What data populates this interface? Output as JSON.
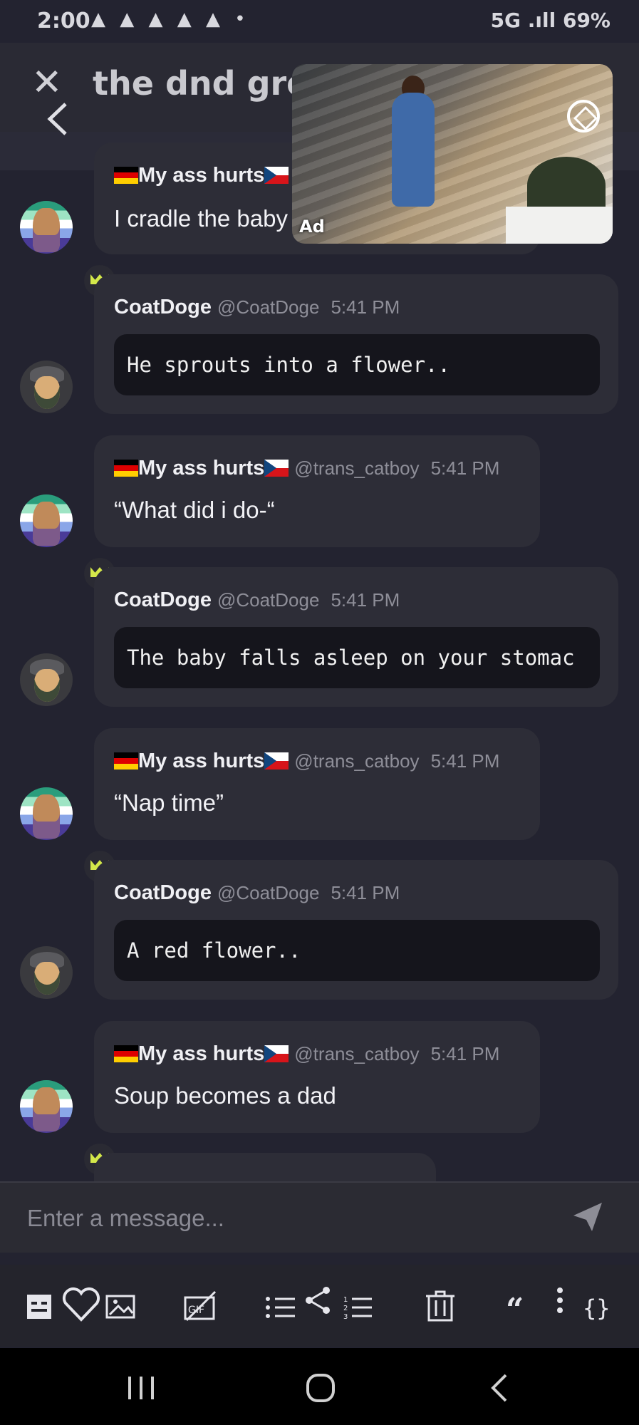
{
  "status_bar": {
    "time": "2:00",
    "notifications": "▲ ▲ ▲ ▲ ▲ •",
    "system": "5G .ıll 69%"
  },
  "header": {
    "title": "the dnd group"
  },
  "ad": {
    "label": "Ad"
  },
  "messages": [
    {
      "author": "My ass hurts",
      "handle": "",
      "time": "",
      "text": "I cradle the baby",
      "kind": "text"
    },
    {
      "author": "CoatDoge",
      "handle": "@CoatDoge",
      "time": "5:41 PM",
      "text": "He sprouts into a flower..",
      "kind": "code"
    },
    {
      "author": "My ass hurts",
      "handle": "@trans_catboy",
      "time": "5:41 PM",
      "text": "“What did i do-“",
      "kind": "text"
    },
    {
      "author": "CoatDoge",
      "handle": "@CoatDoge",
      "time": "5:41 PM",
      "text": "The baby falls asleep on your stomac",
      "kind": "code"
    },
    {
      "author": "My ass hurts",
      "handle": "@trans_catboy",
      "time": "5:41 PM",
      "text": "“Nap time”",
      "kind": "text"
    },
    {
      "author": "CoatDoge",
      "handle": "@CoatDoge",
      "time": "5:41 PM",
      "text": "A red flower..",
      "kind": "code"
    },
    {
      "author": "My ass hurts",
      "handle": "@trans_catboy",
      "time": "5:41 PM",
      "text": "Soup becomes a dad",
      "kind": "text"
    }
  ],
  "composer": {
    "placeholder": "Enter a message..."
  },
  "toolbar": {
    "icons": [
      "spoiler-icon",
      "heart-icon",
      "image-icon",
      "gif-icon",
      "bullet-list-icon",
      "share-icon",
      "numbered-list-icon",
      "delete-icon",
      "quote-icon",
      "more-icon",
      "code-icon"
    ]
  },
  "colors": {
    "background": "#232330",
    "bubble": "#2d2d37",
    "codeblock": "#15151c",
    "crown": "#d4e84a"
  }
}
